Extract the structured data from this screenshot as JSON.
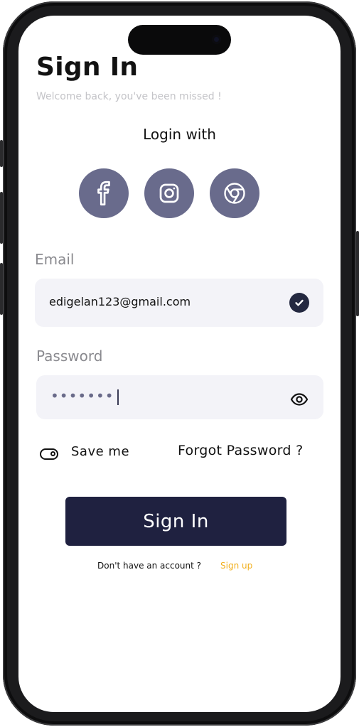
{
  "header": {
    "title": "Sign In",
    "subtitle": "Welcome back, you've been missed !"
  },
  "social": {
    "heading": "Login with",
    "providers": [
      {
        "name": "facebook-icon"
      },
      {
        "name": "instagram-icon"
      },
      {
        "name": "chrome-icon"
      }
    ],
    "button_color": "#696b8c"
  },
  "email": {
    "label": "Email",
    "value": "edigelan123@gmail.com",
    "valid": true
  },
  "password": {
    "label": "Password",
    "masked_value": "•••••••"
  },
  "options": {
    "save_me_label": "Save me",
    "forgot_label": "Forgot Password ?"
  },
  "actions": {
    "signin_label": "Sign In",
    "no_account_text": "Don't have an account ?",
    "signup_label": "Sign up"
  },
  "colors": {
    "primary": "#1f2140",
    "accent": "#f2b01e",
    "field_bg": "#f3f3f8"
  }
}
